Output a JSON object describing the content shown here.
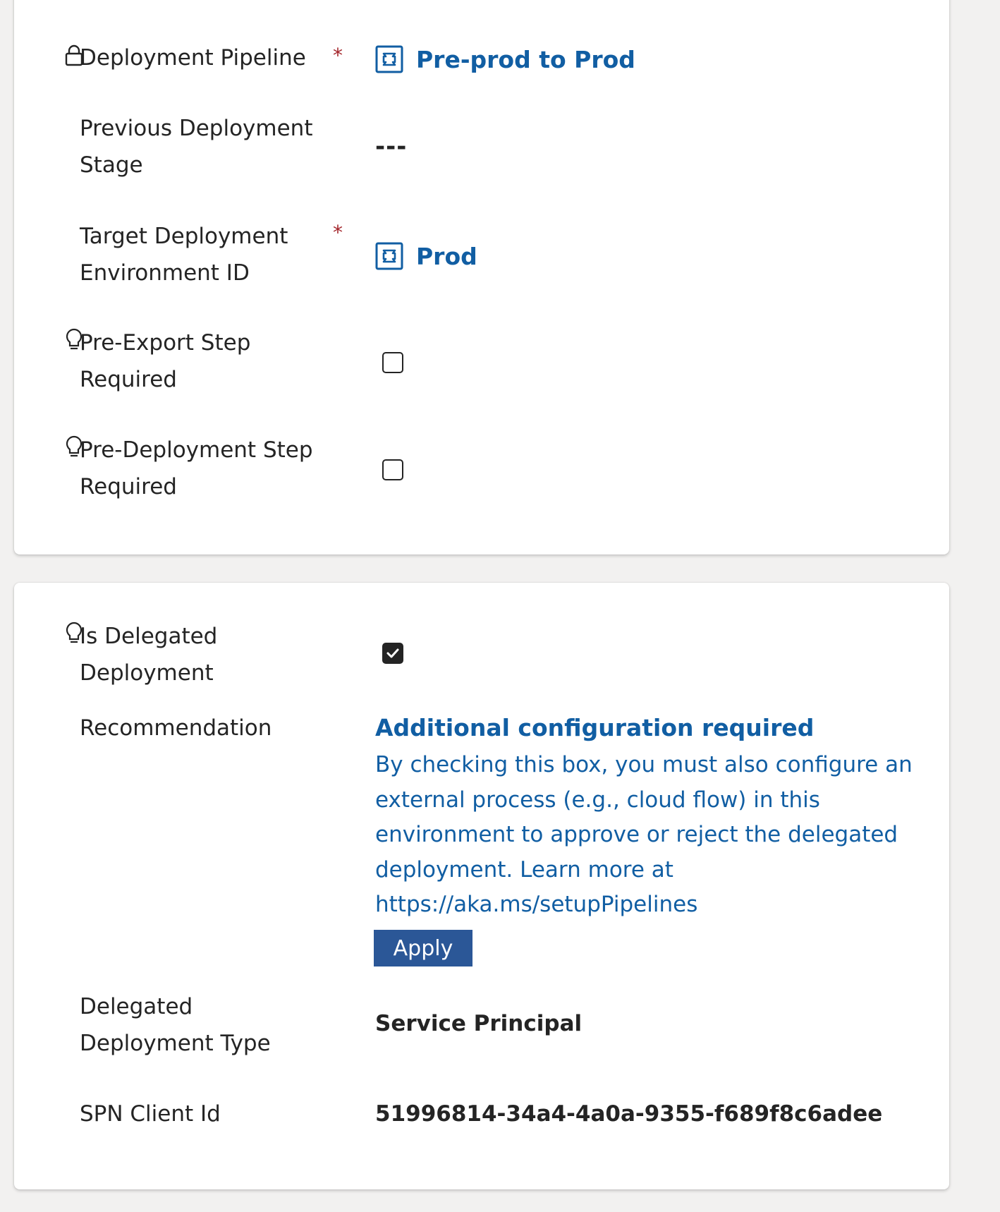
{
  "section1": {
    "deployment_pipeline": {
      "label": "Deployment Pipeline",
      "required_mark": "*",
      "value": "Pre-prod to Prod"
    },
    "previous_stage": {
      "label_line1": "Previous Deployment",
      "label_line2": "Stage",
      "value": "---"
    },
    "target_environment": {
      "label_line1": "Target Deployment",
      "label_line2": "Environment ID",
      "required_mark": "*",
      "value": "Prod"
    },
    "pre_export_step": {
      "label_line1": "Pre-Export Step",
      "label_line2": "Required",
      "checked": false
    },
    "pre_deployment_step": {
      "label_line1": "Pre-Deployment Step",
      "label_line2": "Required",
      "checked": false
    }
  },
  "section2": {
    "is_delegated": {
      "label_line1": "Is Delegated",
      "label_line2": "Deployment",
      "checked": true
    },
    "recommendation": {
      "label": "Recommendation",
      "title": "Additional configuration required",
      "body_lines": [
        "By checking this box, you must also configure an",
        "external process (e.g., cloud flow) in this",
        "environment to approve or reject the delegated",
        "deployment. Learn more at",
        "https://aka.ms/setupPipelines"
      ],
      "button_label": "Apply"
    },
    "delegated_type": {
      "label_line1": "Delegated",
      "label_line2": "Deployment Type",
      "value": "Service Principal"
    },
    "spn_client_id": {
      "label": "SPN Client Id",
      "value": "51996814-34a4-4a0a-9355-f689f8c6adee"
    }
  },
  "colors": {
    "link": "#115ea3",
    "required": "#a4262c",
    "button": "#2b5797",
    "text": "#242424",
    "page_bg": "#f2f1f0"
  }
}
